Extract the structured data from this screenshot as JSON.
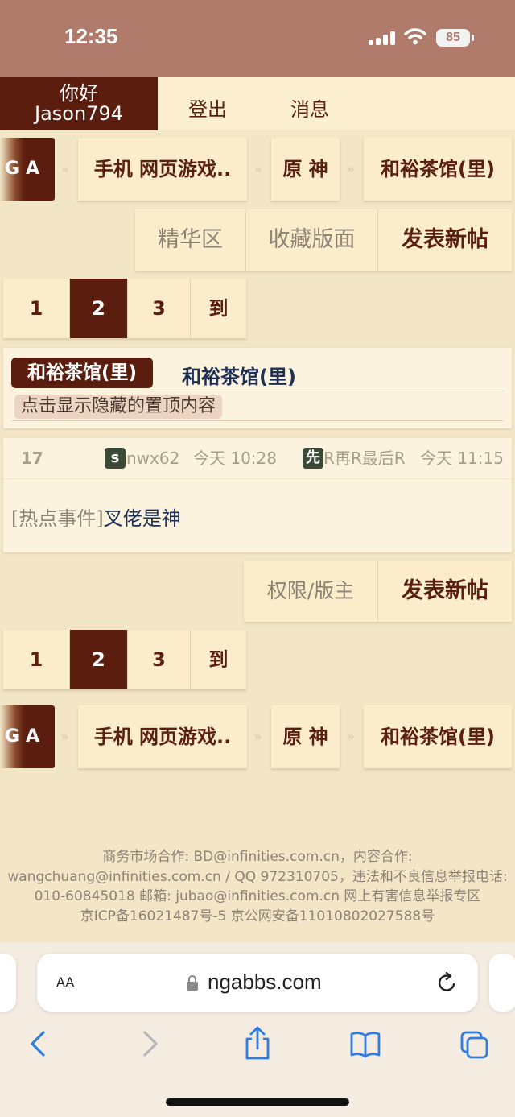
{
  "status_bar": {
    "time": "12:35",
    "battery": "85",
    "icons": [
      "signal-icon",
      "wifi-icon",
      "battery-icon"
    ]
  },
  "header": {
    "greeting": "你好",
    "username": "Jason794",
    "logout": "登出",
    "messages": "消息"
  },
  "breadcrumb": {
    "logo": "GA",
    "separator": "»",
    "items": [
      "手机 网页游戏..",
      "原 神",
      "和裕茶馆(里)"
    ]
  },
  "top_actions": [
    "精华区",
    "收藏版面",
    "发表新帖"
  ],
  "pager": {
    "pages": [
      "1",
      "2",
      "3"
    ],
    "active": "2",
    "goto": "到"
  },
  "forum_info": {
    "tag": "和裕茶馆(里)",
    "forum_name": "和裕茶馆(里)",
    "pinned_toggle": "点击显示隐藏的置顶内容"
  },
  "topic": {
    "reply_count": "17",
    "author_badge": "s",
    "author": "nwx62",
    "post_time": "今天 10:28",
    "last_badge": "先",
    "last_replier": "R再R最后R",
    "last_time": "今天 11:15",
    "category": "[热点事件]",
    "title": "叉佬是神"
  },
  "bottom_actions": [
    "权限/版主",
    "发表新帖"
  ],
  "footer": {
    "line1": "商务市场合作: BD@infinities.com.cn，内容合作:",
    "line2": "wangchuang@infinities.com.cn / QQ 972310705，违法和不良信息举报电话:",
    "line3": "010-60845018 邮箱: jubao@infinities.com.cn 网上有害信息举报专区",
    "line4": "京ICP备16021487号-5 京公网安备11010802027588号"
  },
  "browser": {
    "text_size_label": "AA",
    "domain": "ngabbs.com",
    "toolbar_icons": [
      "back-icon",
      "forward-icon",
      "share-icon",
      "bookmarks-icon",
      "tabs-icon"
    ]
  },
  "colors": {
    "primary": "#5b1d0d",
    "background": "#f2e6c7",
    "panel": "#fbedc9",
    "link": "#1e2f55",
    "status_bar": "#b07b6b"
  }
}
